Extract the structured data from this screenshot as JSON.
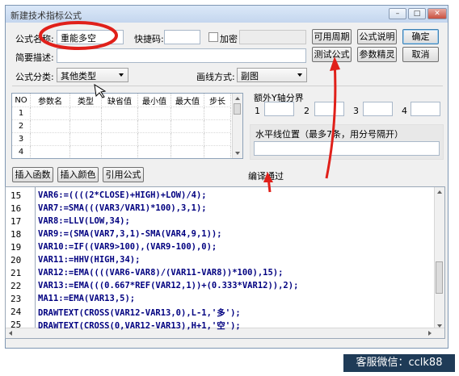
{
  "window": {
    "title": "新建技术指标公式",
    "minimize_glyph": "–",
    "maximize_glyph": "□",
    "close_glyph": "✕"
  },
  "form": {
    "name_label": "公式名称:",
    "name_value": "重能多空",
    "hotkey_label": "快捷码:",
    "hotkey_value": "",
    "encrypt_label": "加密",
    "encrypt_checked": false,
    "desc_label": "简要描述:",
    "desc_value": "",
    "category_label": "公式分类:",
    "category_value": "其他类型",
    "draw_label": "画线方式:",
    "draw_value": "副图"
  },
  "buttons": {
    "period": "可用周期",
    "help": "公式说明",
    "ok": "确定",
    "test": "测试公式",
    "params": "参数精灵",
    "cancel": "取消",
    "insert_func": "插入函数",
    "insert_color": "插入颜色",
    "ref_formula": "引用公式"
  },
  "params_table": {
    "headers": [
      "NO",
      "参数名",
      "类型",
      "缺省值",
      "最小值",
      "最大值",
      "步长"
    ],
    "rows": [
      "1",
      "2",
      "3",
      "4"
    ]
  },
  "yaxis": {
    "label": "额外Y轴分界",
    "slots": [
      "1",
      "2",
      "3",
      "4"
    ]
  },
  "hline": {
    "label": "水平线位置（最多7条，用分号隔开）",
    "value": ""
  },
  "status": "编译通过",
  "code": {
    "line_numbers": [
      "15",
      "16",
      "17",
      "18",
      "19",
      "20",
      "21",
      "22",
      "23",
      "24",
      "25"
    ],
    "lines": [
      "VAR6:=((((2*CLOSE)+HIGH)+LOW)/4);",
      "VAR7:=SMA(((VAR3/VAR1)*100),3,1);",
      "VAR8:=LLV(LOW,34);",
      "VAR9:=(SMA(VAR7,3,1)-SMA(VAR4,9,1));",
      "VAR10:=IF((VAR9>100),(VAR9-100),0);",
      "VAR11:=HHV(HIGH,34);",
      "VAR12:=EMA((((VAR6-VAR8)/(VAR11-VAR8))*100),15);",
      "VAR13:=EMA(((0.667*REF(VAR12,1))+(0.333*VAR12)),2);",
      "MA11:=EMA(VAR13,5);",
      "DRAWTEXT(CROSS(VAR12-VAR13,0),L-1,'多');",
      "DRAWTEXT(CROSS(0,VAR12-VAR13),H+1,'空');"
    ]
  },
  "watermark": "客服微信：cclk88",
  "colors": {
    "annotation": "#e0201a",
    "code_text": "#000080",
    "badge_bg": "#1f3b57"
  }
}
